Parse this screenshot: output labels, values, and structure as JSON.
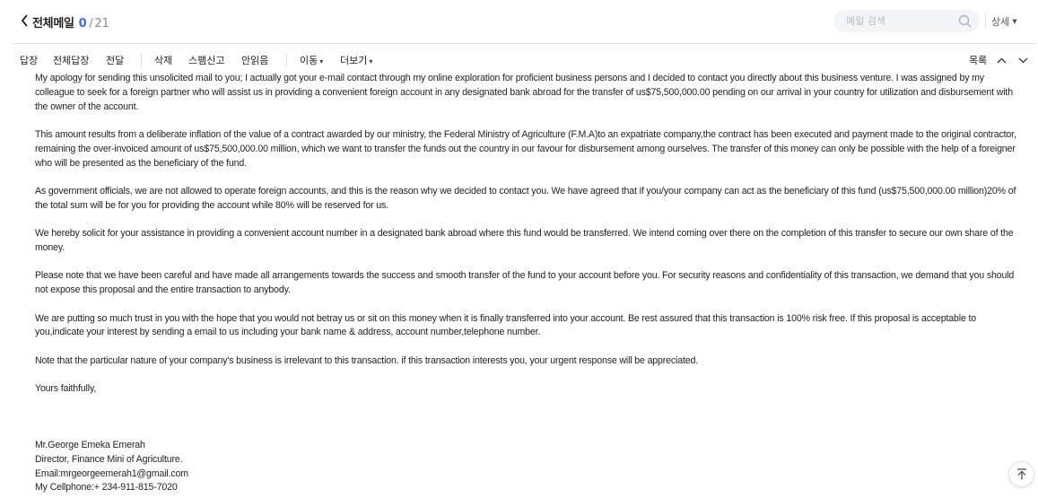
{
  "header": {
    "title": "전체메일",
    "unread": "0",
    "sep": "/",
    "total": "21",
    "search_placeholder": "메일 검색",
    "detail_label": "상세"
  },
  "toolbar": {
    "reply": "답장",
    "reply_all": "전체답장",
    "forward": "전달",
    "delete": "삭제",
    "spam": "스팸신고",
    "mark_unread": "안읽음",
    "move": "이동",
    "more": "더보기",
    "list": "목록"
  },
  "message": {
    "paragraphs": [
      "My apology for sending this unsolicited mail to you; I actually got your e-mail contact through my online exploration for proficient business persons and I decided to contact you directly about this business venture. I was assigned by my colleague to seek for a foreign partner who will assist us in providing a convenient foreign account in any designated bank abroad for the transfer of us$75,500,000.00 pending on our arrival in your country for utilization and disbursement with the owner of the account.",
      "This amount results from a deliberate inflation of the value of a contract awarded by our ministry, the Federal Ministry of Agriculture (F.M.A)to an expatriate company,the contract has been executed and payment made to the original contractor, remaining the over-invoiced amount of us$75,500,000.00 million, which we want to transfer the funds out the country in our favour for disbursement among ourselves. The transfer of this money can only be possible with the help of a foreigner who will be presented as the beneficiary of the fund.",
      "As government officials, we are not allowed to operate foreign accounts, and this is the reason why we decided to contact you. We have agreed that if you/your company can act as the beneficiary of this fund (us$75,500,000.00 million)20% of the total sum will be for you for providing the account while 80% will be reserved for us.",
      "We hereby solicit for your assistance in providing a convenient account number in a designated bank abroad where this fund would be transferred. We intend coming over there on the completion of this transfer to secure our own share of the money.",
      "Please note that we have been careful and have made all arrangements towards the success and smooth transfer of the fund to your account before you. For security reasons and confidentiality of this transaction, we demand that you should not expose this proposal and the entire transaction to anybody.",
      "We are putting so much trust in you with the hope that you would not betray us or sit on this money when it is finally transferred into your account. Be rest assured that this transaction is 100% risk free. If this proposal is acceptable to you,indicate your interest by sending a email to us including your bank name & address, account number,telephone number.",
      "Note that the particular nature of your company's business is irrelevant to this transaction. if this transaction interests you, your urgent response will be appreciated.",
      "Yours faithfully,"
    ],
    "signature": [
      "Mr.George Emeka Emerah",
      "Director, Finance Mini of Agriculture.",
      "Email:mrgeorgeemerah1@gmail.com",
      "My Cellphone:+ 234-911-815-7020"
    ]
  },
  "icons": {
    "back": "chevron-left-icon",
    "search": "search-icon",
    "prev": "chevron-up-icon",
    "next": "chevron-down-icon",
    "scroll_top": "arrow-up-icon"
  },
  "colors": {
    "accent": "#3a6fe0",
    "search_bg": "#f2f4f7"
  }
}
